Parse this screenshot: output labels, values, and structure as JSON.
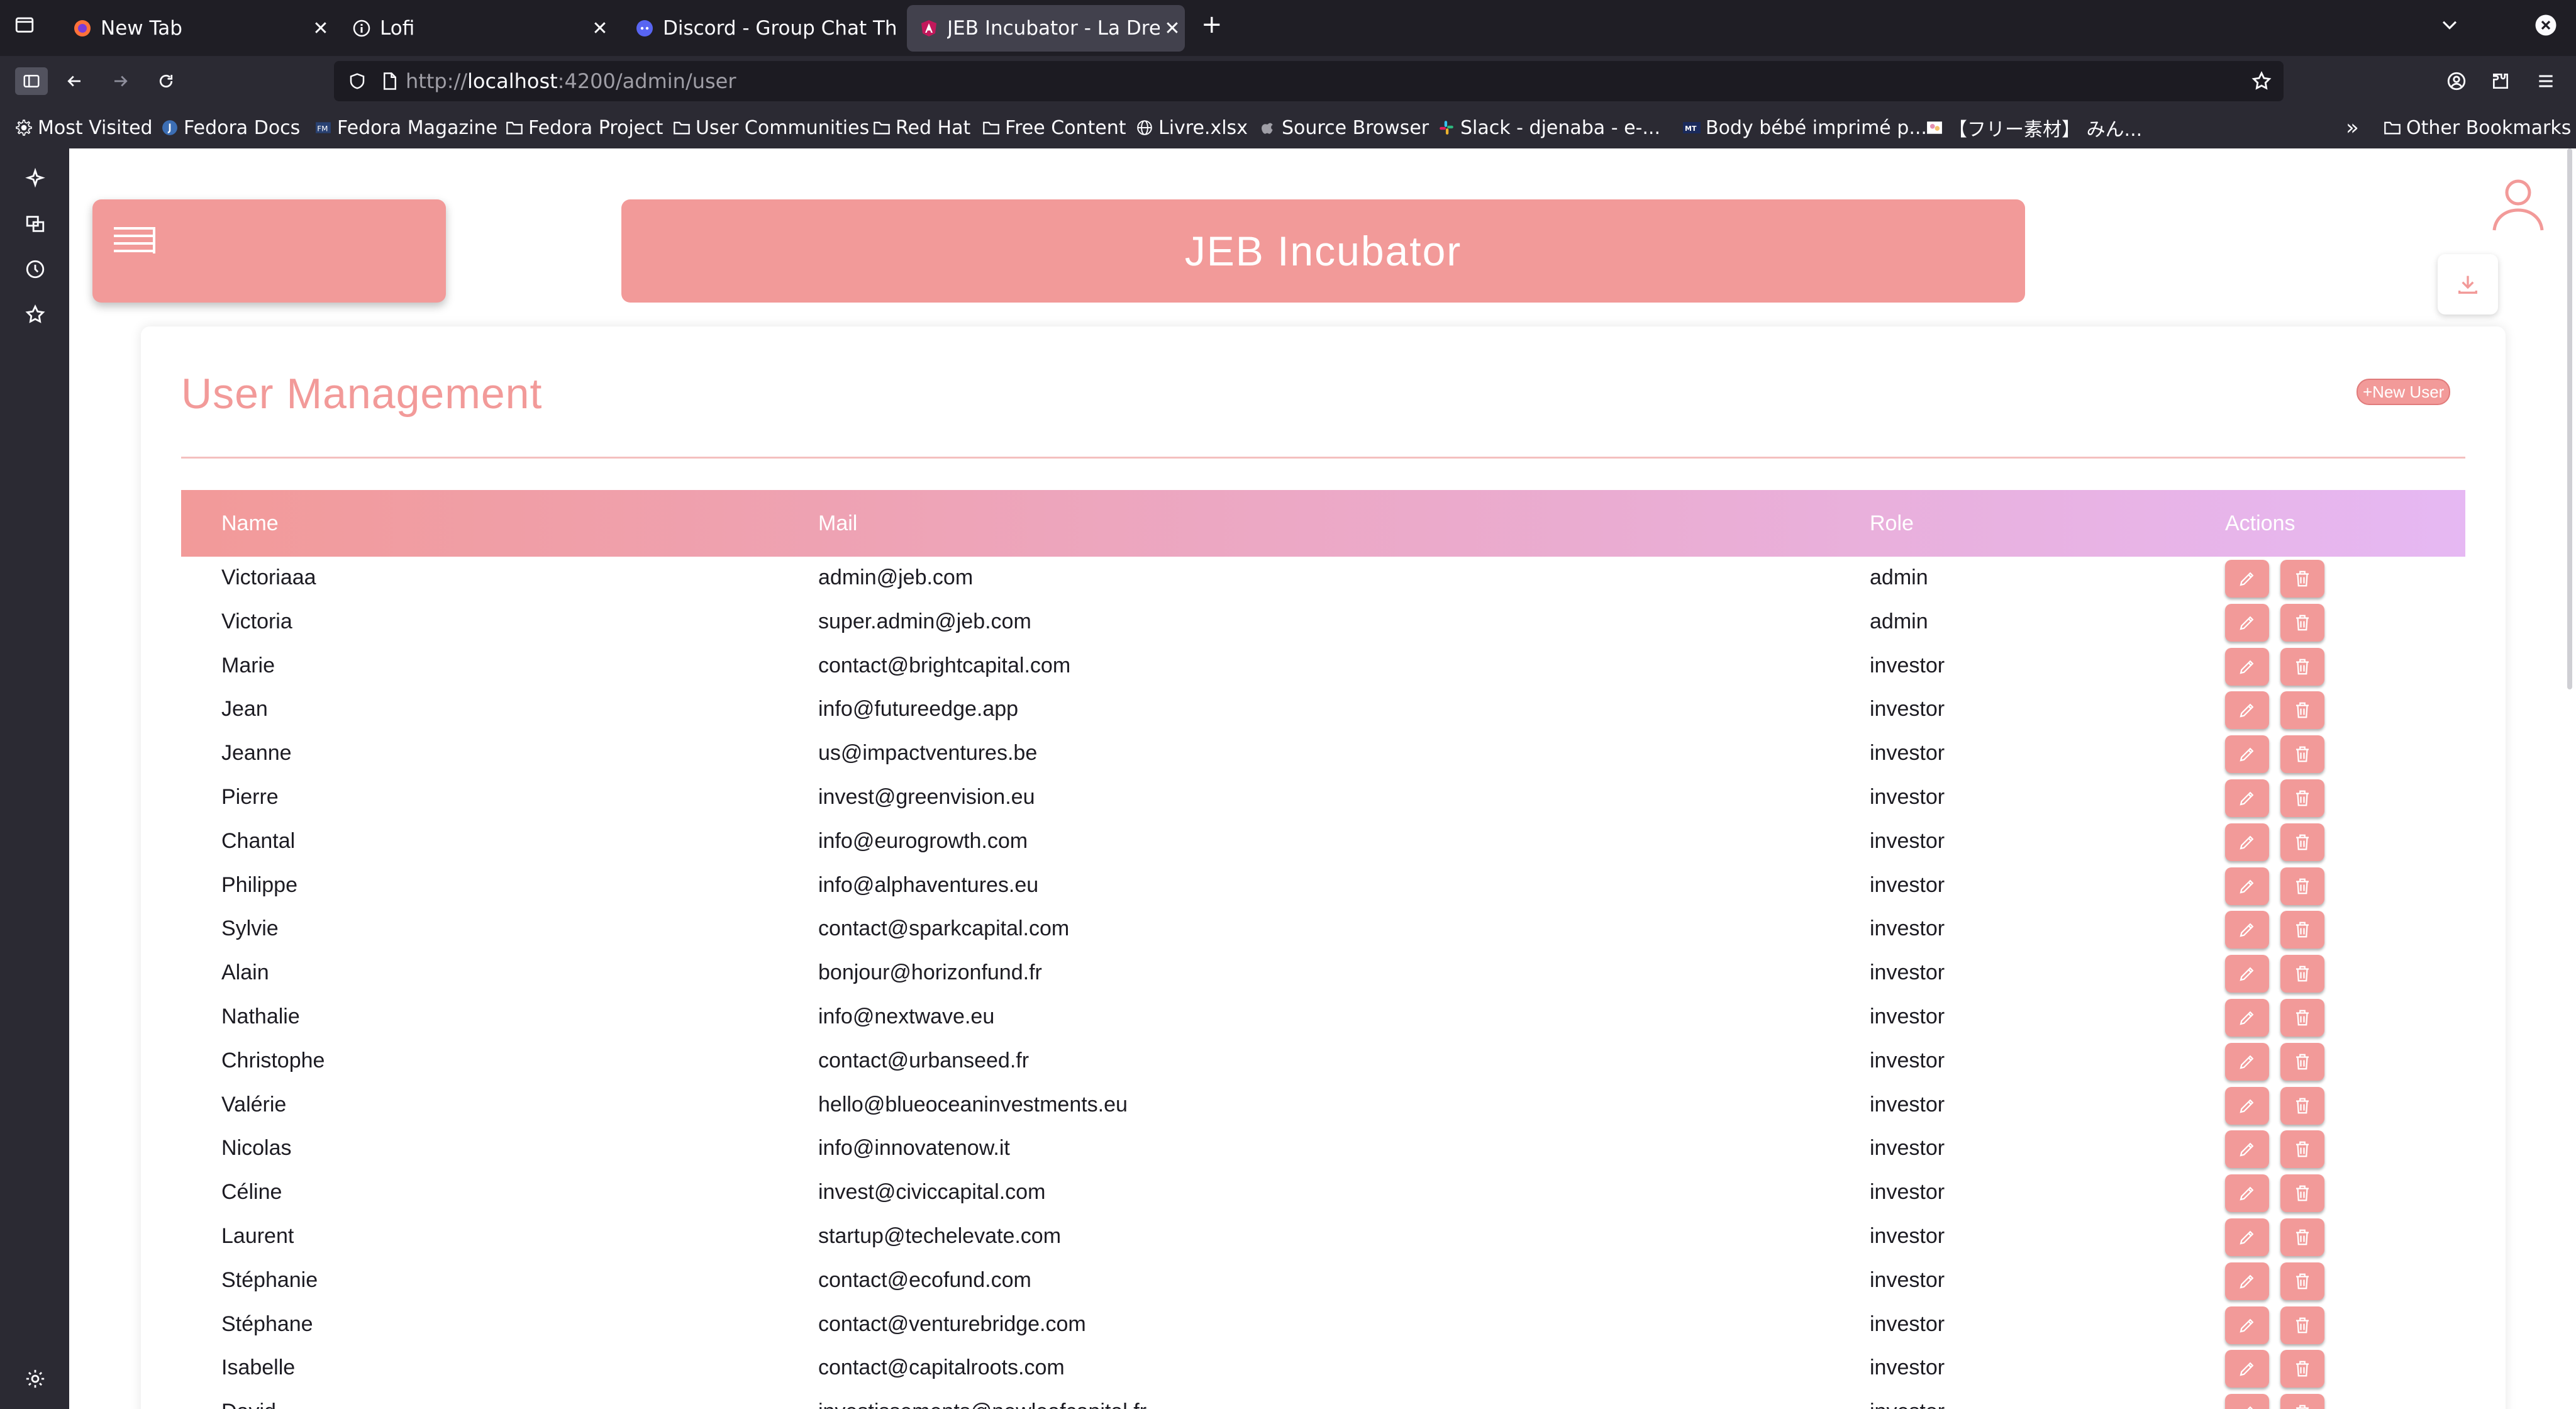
{
  "browser": {
    "tabs": [
      {
        "label": "New Tab",
        "favicon": "firefox-icon",
        "active": false
      },
      {
        "label": "Lofi",
        "favicon": "info-icon",
        "active": false
      },
      {
        "label": "Discord - Group Chat Th",
        "favicon": "discord-icon",
        "active": false
      },
      {
        "label": "JEB Incubator - La Drea",
        "favicon": "angular-icon",
        "active": true
      }
    ],
    "url": {
      "protocol": "http://",
      "host": "localhost",
      "path": ":4200/admin/user"
    },
    "bookmarks": [
      {
        "label": "Most Visited",
        "icon": "gear-icon"
      },
      {
        "label": "Fedora Docs",
        "icon": "fedora-icon"
      },
      {
        "label": "Fedora Magazine",
        "icon": "fm-icon"
      },
      {
        "label": "Fedora Project",
        "icon": "folder-icon"
      },
      {
        "label": "User Communities",
        "icon": "folder-icon"
      },
      {
        "label": "Red Hat",
        "icon": "folder-icon"
      },
      {
        "label": "Free Content",
        "icon": "folder-icon"
      },
      {
        "label": "Livre.xlsx",
        "icon": "globe-icon"
      },
      {
        "label": "Source Browser",
        "icon": "apple-icon"
      },
      {
        "label": "Slack - djenaba - e-...",
        "icon": "slack-icon"
      },
      {
        "label": "Body bébé imprimé p...",
        "icon": "mt-icon"
      },
      {
        "label": "【フリー素材】 みん...",
        "icon": "image-icon"
      }
    ],
    "other_bookmarks": "Other Bookmarks"
  },
  "app": {
    "title": "JEB Incubator",
    "accent": "#f29a99"
  },
  "user_management": {
    "title": "User Management",
    "new_user_label": "+New User",
    "columns": {
      "name": "Name",
      "mail": "Mail",
      "role": "Role",
      "actions": "Actions"
    },
    "rows": [
      {
        "name": "Victoriaaa",
        "mail": "admin@jeb.com",
        "role": "admin"
      },
      {
        "name": "Victoria",
        "mail": "super.admin@jeb.com",
        "role": "admin"
      },
      {
        "name": "Marie",
        "mail": "contact@brightcapital.com",
        "role": "investor"
      },
      {
        "name": "Jean",
        "mail": "info@futureedge.app",
        "role": "investor"
      },
      {
        "name": "Jeanne",
        "mail": "us@impactventures.be",
        "role": "investor"
      },
      {
        "name": "Pierre",
        "mail": "invest@greenvision.eu",
        "role": "investor"
      },
      {
        "name": "Chantal",
        "mail": "info@eurogrowth.com",
        "role": "investor"
      },
      {
        "name": "Philippe",
        "mail": "info@alphaventures.eu",
        "role": "investor"
      },
      {
        "name": "Sylvie",
        "mail": "contact@sparkcapital.com",
        "role": "investor"
      },
      {
        "name": "Alain",
        "mail": "bonjour@horizonfund.fr",
        "role": "investor"
      },
      {
        "name": "Nathalie",
        "mail": "info@nextwave.eu",
        "role": "investor"
      },
      {
        "name": "Christophe",
        "mail": "contact@urbanseed.fr",
        "role": "investor"
      },
      {
        "name": "Valérie",
        "mail": "hello@blueoceaninvestments.eu",
        "role": "investor"
      },
      {
        "name": "Nicolas",
        "mail": "info@innovatenow.it",
        "role": "investor"
      },
      {
        "name": "Céline",
        "mail": "invest@civiccapital.com",
        "role": "investor"
      },
      {
        "name": "Laurent",
        "mail": "startup@techelevate.com",
        "role": "investor"
      },
      {
        "name": "Stéphanie",
        "mail": "contact@ecofund.com",
        "role": "investor"
      },
      {
        "name": "Stéphane",
        "mail": "contact@venturebridge.com",
        "role": "investor"
      },
      {
        "name": "Isabelle",
        "mail": "contact@capitalroots.com",
        "role": "investor"
      },
      {
        "name": "David",
        "mail": "investissements@newleafcapital.fr",
        "role": "investor"
      }
    ]
  }
}
